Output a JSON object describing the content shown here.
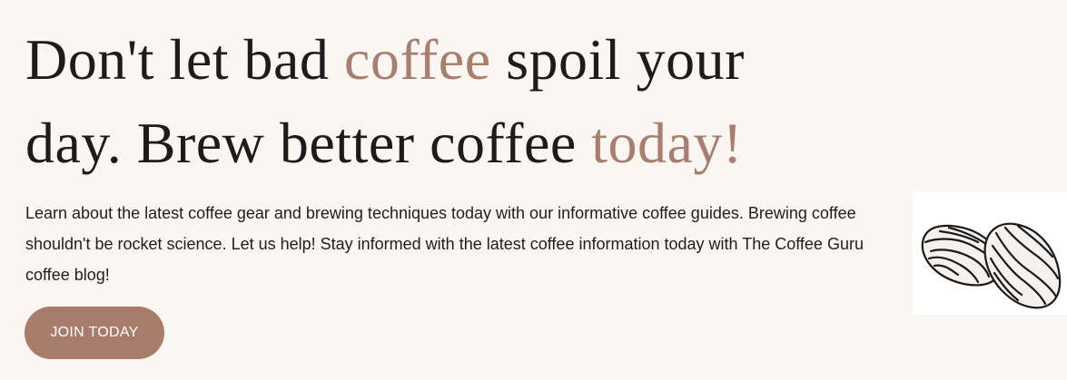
{
  "hero": {
    "title_part1": "Don't let bad ",
    "title_accent1": "coffee",
    "title_part2": " spoil your day. Brew better coffee ",
    "title_accent2": "today!",
    "description": "Learn about the latest coffee gear and brewing techniques today with our informative coffee guides. Brewing coffee shouldn't be rocket science. Let us help! Stay informed with the latest coffee information today with The Coffee Guru coffee blog!",
    "cta_label": "JOIN TODAY"
  },
  "colors": {
    "background": "#fbf6f2",
    "accent": "#a87f6e",
    "button": "#a87c6b",
    "text": "#1d1b1b"
  },
  "decoration": {
    "icon": "coffee-beans-illustration"
  }
}
